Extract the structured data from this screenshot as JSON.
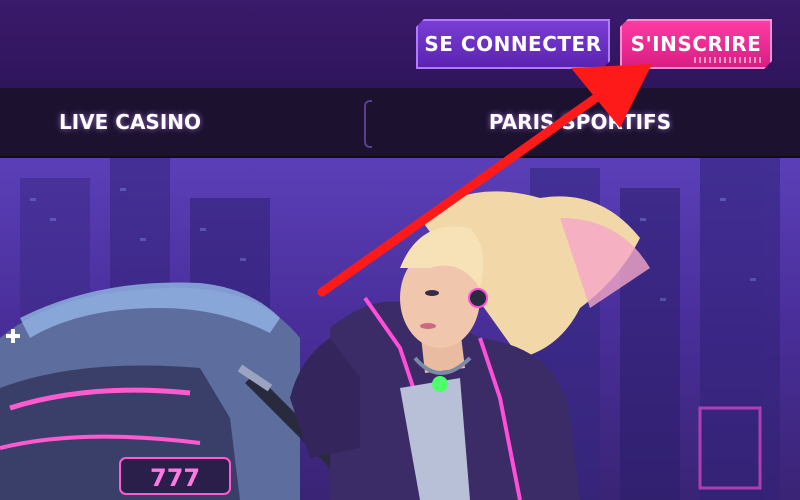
{
  "header": {
    "login_label": "SE CONNECTER",
    "signup_label": "S'INSCRIRE"
  },
  "nav": {
    "items": [
      {
        "label": "LIVE CASINO"
      },
      {
        "label": "PARIS SPORTIFS"
      }
    ]
  },
  "hero": {
    "plate_text": "777"
  },
  "colors": {
    "header_bg": "#3a1a6b",
    "login_bg": "#6a2fc4",
    "signup_bg": "#ef2a93",
    "nav_bg": "#1c1230",
    "arrow": "#ff1a1a"
  }
}
